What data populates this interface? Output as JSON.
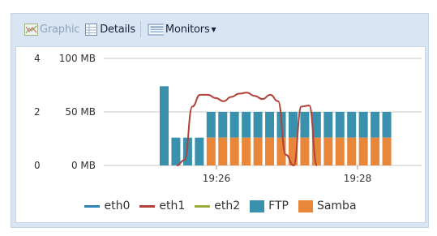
{
  "toolbar": {
    "graphic_label": "Graphic",
    "details_label": "Details",
    "monitors_label": "Monitors",
    "graphic_icon": "chart-icon",
    "details_icon": "table-icon",
    "monitors_icon": "monitor-icon"
  },
  "colors": {
    "eth0": "#2e82b4",
    "eth1": "#b0423a",
    "eth2": "#96ad3c",
    "ftp": "#3a91ad",
    "samba": "#e8863a"
  },
  "chart_data": {
    "type": "bar",
    "left_axis_ticks": [
      "4",
      "2",
      "0"
    ],
    "right_axis_ticks": [
      "100 MB",
      "50 MB",
      "0 MB"
    ],
    "x_ticks": [
      "19:26",
      "19:28"
    ],
    "legend": [
      "eth0",
      "eth1",
      "eth2",
      "FTP",
      "Samba"
    ],
    "ylim": [
      0,
      100
    ],
    "series": [
      {
        "name": "FTP",
        "values": [
          74,
          26,
          26,
          26,
          50,
          50,
          50,
          50,
          50,
          50,
          50,
          50,
          50,
          50,
          50,
          50,
          50,
          50,
          50,
          50
        ]
      },
      {
        "name": "Samba",
        "values": [
          0,
          0,
          0,
          0,
          26,
          26,
          26,
          26,
          26,
          26,
          26,
          26,
          26,
          26,
          26,
          26,
          26,
          26,
          26,
          26
        ]
      },
      {
        "name": "eth1",
        "values": [
          0,
          5,
          55,
          66,
          66,
          63,
          60,
          64,
          67,
          68,
          65,
          62,
          66,
          60,
          10,
          0,
          55,
          56,
          0
        ]
      }
    ]
  }
}
